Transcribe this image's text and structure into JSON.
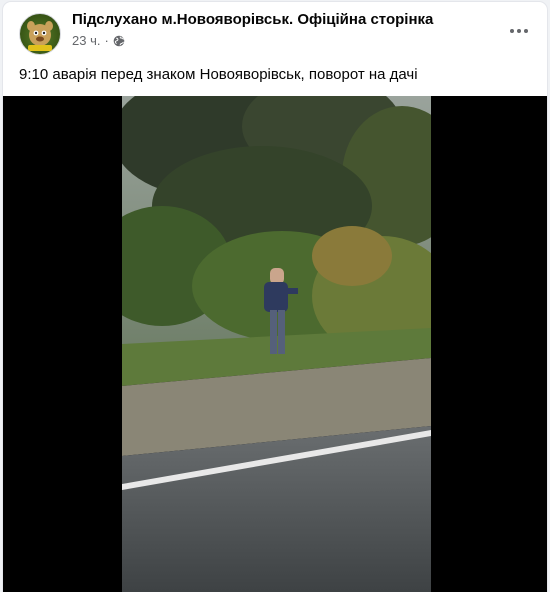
{
  "post": {
    "page_name": "Підслухано м.Новояворівськ. Офіційна сторінка",
    "time": "23 ч.",
    "separator": "·",
    "text": "9:10 аварія перед знаком Новояворівськ, поворот на дачі"
  },
  "icons": {
    "avatar": "page-logo",
    "audience": "globe-icon",
    "menu": "more-options-icon"
  },
  "colors": {
    "background": "#f0f2f5",
    "card": "#ffffff",
    "primary_text": "#050505",
    "secondary_text": "#65676b",
    "video_background": "#000000"
  }
}
